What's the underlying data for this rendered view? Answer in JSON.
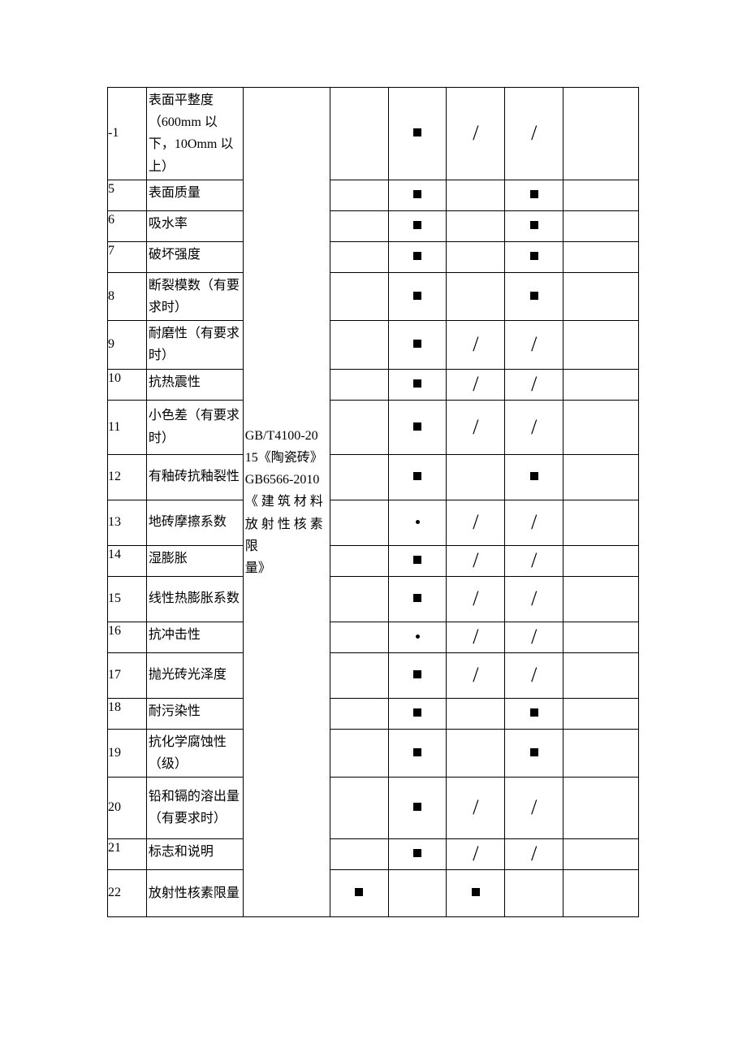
{
  "standards_text_line1": "GB/T4100-20",
  "standards_text_line2": "15《陶瓷砖》",
  "standards_text_line3": "GB6566-2010",
  "standards_text_line4": "《 建 筑 材 料",
  "standards_text_line5": "放 射 性 核 素 限",
  "standards_text_line6": "量》",
  "rows": [
    {
      "idx": "-1",
      "name": "表面平整度（600mm 以下，10Omm 以上）",
      "a": "",
      "b": "sq",
      "c": "slash",
      "d": "slash",
      "e": ""
    },
    {
      "idx": "5",
      "name": "表面质量",
      "a": "",
      "b": "sq",
      "c": "",
      "d": "sq",
      "e": ""
    },
    {
      "idx": "6",
      "name": "吸水率",
      "a": "",
      "b": "sq",
      "c": "",
      "d": "sq",
      "e": ""
    },
    {
      "idx": "7",
      "name": "破坏强度",
      "a": "",
      "b": "sq",
      "c": "",
      "d": "sq",
      "e": ""
    },
    {
      "idx": "8",
      "name": "断裂模数（有要求时）",
      "a": "",
      "b": "sq",
      "c": "",
      "d": "sq",
      "e": ""
    },
    {
      "idx": "9",
      "name": "耐磨性（有要求时）",
      "a": "",
      "b": "sq",
      "c": "slash",
      "d": "slash",
      "e": ""
    },
    {
      "idx": "10",
      "name": "抗热震性",
      "a": "",
      "b": "sq",
      "c": "slash",
      "d": "slash",
      "e": ""
    },
    {
      "idx": "11",
      "name": "小色差（有要求时）",
      "a": "",
      "b": "sq",
      "c": "slash",
      "d": "slash",
      "e": ""
    },
    {
      "idx": "12",
      "name": "有釉砖抗釉裂性",
      "a": "",
      "b": "sq",
      "c": "",
      "d": "sq",
      "e": ""
    },
    {
      "idx": "13",
      "name": "地砖摩擦系数",
      "a": "",
      "b": "dot",
      "c": "slash",
      "d": "slash",
      "e": ""
    },
    {
      "idx": "14",
      "name": "湿膨胀",
      "a": "",
      "b": "sq",
      "c": "slash",
      "d": "slash",
      "e": ""
    },
    {
      "idx": "15",
      "name": "线性热膨胀系数",
      "a": "",
      "b": "sq",
      "c": "slash",
      "d": "slash",
      "e": ""
    },
    {
      "idx": "16",
      "name": "抗冲击性",
      "a": "",
      "b": "dot",
      "c": "slash",
      "d": "slash",
      "e": ""
    },
    {
      "idx": "17",
      "name": "抛光砖光泽度",
      "a": "",
      "b": "sq",
      "c": "slash",
      "d": "slash",
      "e": ""
    },
    {
      "idx": "18",
      "name": "耐污染性",
      "a": "",
      "b": "sq",
      "c": "",
      "d": "sq",
      "e": ""
    },
    {
      "idx": "19",
      "name": "抗化学腐蚀性（级）",
      "a": "",
      "b": "sq",
      "c": "",
      "d": "sq",
      "e": ""
    },
    {
      "idx": "20",
      "name": "铅和镉的溶出量（有要求时）",
      "a": "",
      "b": "sq",
      "c": "slash",
      "d": "slash",
      "e": ""
    },
    {
      "idx": "21",
      "name": "标志和说明",
      "a": "",
      "b": "sq",
      "c": "slash",
      "d": "slash",
      "e": ""
    },
    {
      "idx": "22",
      "name": "放射性核素限量",
      "a": "sq",
      "b": "",
      "c": "sq",
      "d": "",
      "e": ""
    }
  ]
}
